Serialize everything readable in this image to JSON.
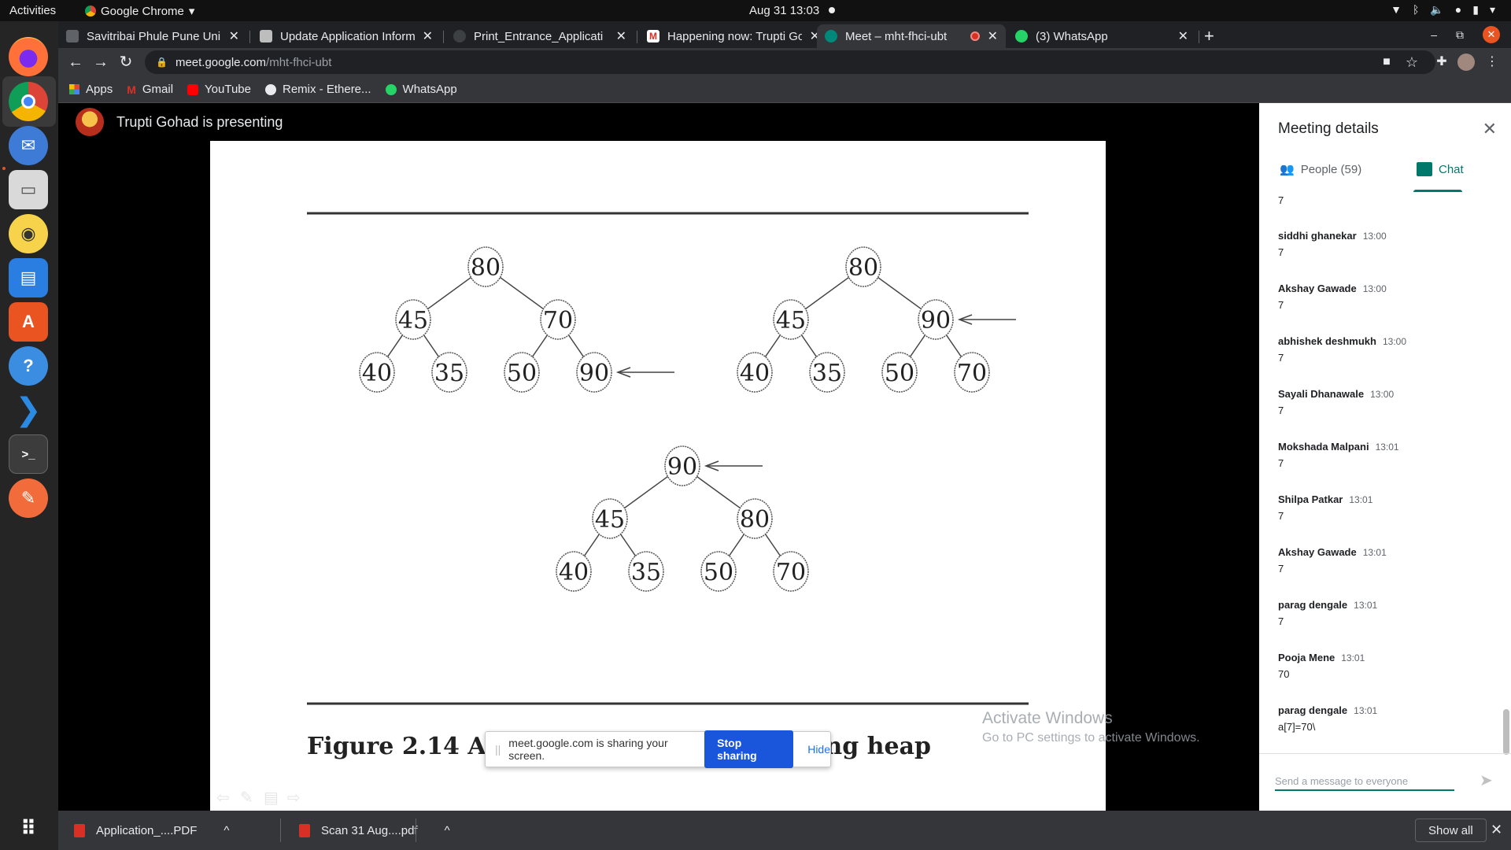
{
  "os": {
    "activities_label": "Activities",
    "app_name": "Google Chrome",
    "clock": "Aug 31  13:03"
  },
  "browser": {
    "tabs": [
      {
        "title": "Savitribai Phule Pune Uni",
        "active": false
      },
      {
        "title": "Update Application Inform",
        "active": false
      },
      {
        "title": "Print_Entrance_Applicati",
        "active": false
      },
      {
        "title": "Happening now: Trupti Go",
        "active": false
      },
      {
        "title": "Meet – mht-fhci-ubt",
        "active": true
      },
      {
        "title": "(3) WhatsApp",
        "active": false
      }
    ],
    "url_host": "meet.google.com",
    "url_path": "/mht-fhci-ubt",
    "bookmarks": [
      "Apps",
      "Gmail",
      "YouTube",
      "Remix - Ethere...",
      "WhatsApp"
    ]
  },
  "meet": {
    "presenter_text": "Trupti Gohad is presenting",
    "slide": {
      "trees": [
        {
          "nodes": [
            "80",
            "45",
            "70",
            "40",
            "35",
            "50",
            "90"
          ]
        },
        {
          "nodes": [
            "80",
            "45",
            "90",
            "40",
            "35",
            "50",
            "70"
          ]
        },
        {
          "nodes": [
            "90",
            "45",
            "80",
            "40",
            "35",
            "50",
            "70"
          ]
        }
      ],
      "caption_start": "Figure 2.14  Acti",
      "caption_end": "ing heap"
    },
    "share_banner": {
      "message": "meet.google.com is sharing your screen.",
      "stop_label": "Stop sharing",
      "hide_label": "Hide"
    },
    "watermark": {
      "line1": "Activate Windows",
      "line2": "Go to PC settings to activate Windows."
    }
  },
  "panel": {
    "title": "Meeting details",
    "people_tab": "People (59)",
    "chat_tab": "Chat",
    "first_partial_text": "7",
    "messages": [
      {
        "name": "siddhi ghanekar",
        "time": "13:00",
        "text": "7"
      },
      {
        "name": "Akshay Gawade",
        "time": "13:00",
        "text": "7"
      },
      {
        "name": "abhishek deshmukh",
        "time": "13:00",
        "text": "7"
      },
      {
        "name": "Sayali Dhanawale",
        "time": "13:00",
        "text": "7"
      },
      {
        "name": "Mokshada Malpani",
        "time": "13:01",
        "text": "7"
      },
      {
        "name": "Shilpa Patkar",
        "time": "13:01",
        "text": "7"
      },
      {
        "name": "Akshay Gawade",
        "time": "13:01",
        "text": "7"
      },
      {
        "name": "parag dengale",
        "time": "13:01",
        "text": "7"
      },
      {
        "name": "Pooja Mene",
        "time": "13:01",
        "text": "70"
      },
      {
        "name": "parag dengale",
        "time": "13:01",
        "text": "a[7]=70\\"
      }
    ],
    "compose_placeholder": "Send a message to everyone"
  },
  "downloads": {
    "items": [
      "Application_....PDF",
      "Scan 31 Aug....pdf"
    ],
    "show_all": "Show all"
  },
  "colors": {
    "meet_accent": "#00796b",
    "stop_sharing": "#1a56db",
    "ubuntu_orange": "#e95420"
  }
}
